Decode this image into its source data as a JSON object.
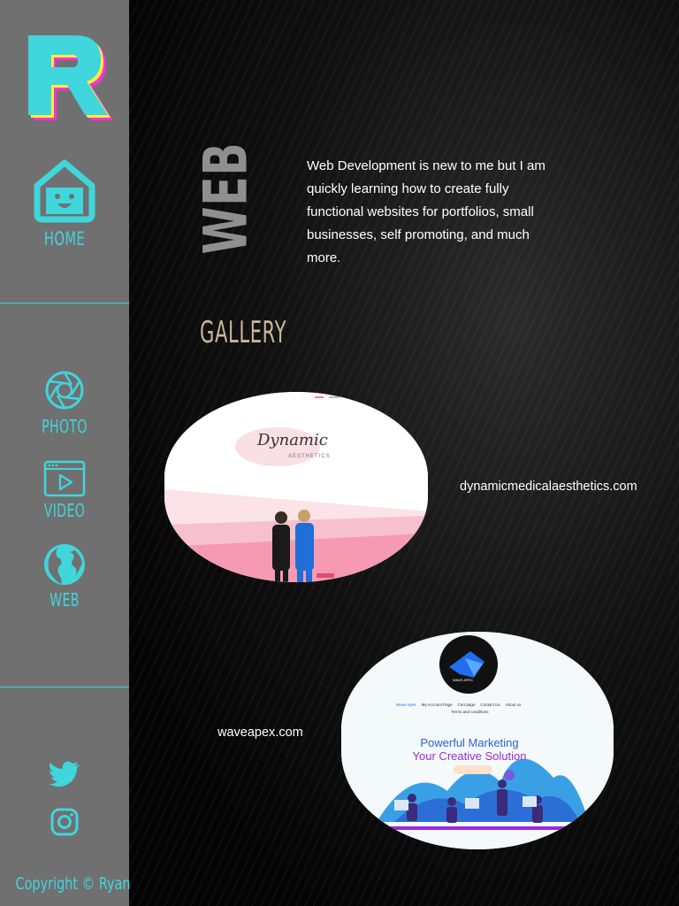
{
  "sidebar": {
    "logo_letter": "R",
    "nav": {
      "home": "HOME",
      "photo": "PHOTO",
      "video": "VIDEO",
      "web": "WEB"
    },
    "copyright": "Copyright © Ryan"
  },
  "main": {
    "section_title": "WEB",
    "intro": "Web Development is new to me but I am quickly learning how to create fully functional websites for portfolios, small businesses, self promoting, and much more.",
    "gallery_title": "GALLERY",
    "projects": [
      {
        "link": "dynamicmedicalaesthetics.com",
        "preview": {
          "logo_text": "Dynamic",
          "logo_sub": "AESTHETICS"
        }
      },
      {
        "link": "waveapex.com",
        "preview": {
          "logo_text": "WAVE APEX",
          "nav": [
            "Wave Apex",
            "My Account Page",
            "Cart page",
            "Contact Us",
            "About us"
          ],
          "nav_extra": "Terms and conditions",
          "headline_1": "Powerful Marketing",
          "headline_2": "Your Creative Solution"
        }
      }
    ]
  },
  "colors": {
    "accent": "#3fd6dc",
    "sidebar_bg": "#707070",
    "gallery_title": "#c9b79a",
    "pink": "#f27fa0",
    "purple": "#9a2bd8"
  }
}
